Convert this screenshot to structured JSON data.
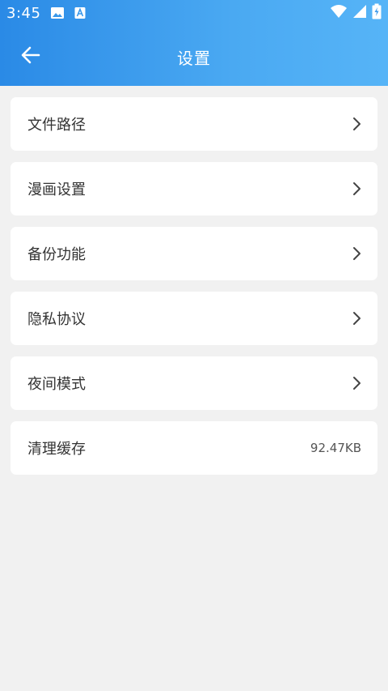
{
  "status_bar": {
    "time": "3:45",
    "icons": [
      "image-icon",
      "font-a-icon",
      "wifi-icon",
      "signal-icon",
      "battery-charging-icon"
    ]
  },
  "header": {
    "title": "设置",
    "back_icon": "arrow-left-icon"
  },
  "colors": {
    "header_start": "#2a8ae6",
    "header_end": "#56b4f7",
    "background": "#f1f1f1",
    "card": "#ffffff"
  },
  "settings": [
    {
      "label": "文件路径",
      "trailing": "chevron-right-icon"
    },
    {
      "label": "漫画设置",
      "trailing": "chevron-right-icon"
    },
    {
      "label": "备份功能",
      "trailing": "chevron-right-icon"
    },
    {
      "label": "隐私协议",
      "trailing": "chevron-right-icon"
    },
    {
      "label": "夜间模式",
      "trailing": "chevron-right-icon"
    },
    {
      "label": "清理缓存",
      "value": "92.47KB"
    }
  ]
}
